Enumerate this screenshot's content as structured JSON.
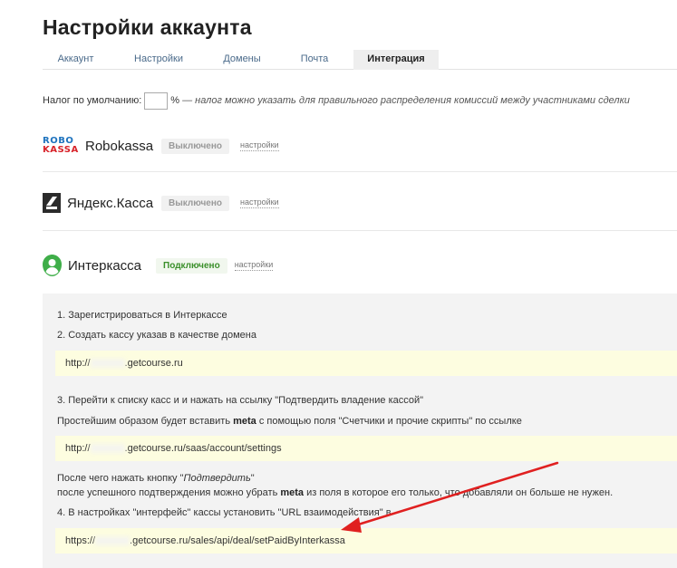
{
  "page": {
    "title": "Настройки аккаунта"
  },
  "tabs": [
    {
      "label": "Аккаунт"
    },
    {
      "label": "Настройки"
    },
    {
      "label": "Домены"
    },
    {
      "label": "Почта"
    },
    {
      "label": "Интеграция"
    }
  ],
  "active_tab": "Интеграция",
  "tax": {
    "label": "Налог по умолчанию:",
    "value": "",
    "percent": "%",
    "note": "— налог можно указать для правильного распределения комиссий между участниками сделки"
  },
  "providers": [
    {
      "logo_top": "ROBO",
      "logo_bottom": "KASSA",
      "name": "Robokassa",
      "status": "Выключено",
      "link": "настройки",
      "icon": "robokassa-logo"
    },
    {
      "name": "Яндекс.Касса",
      "status": "Выключено",
      "link": "настройки",
      "icon": "yandex-kassa-logo"
    },
    {
      "name": "Интеркасса",
      "status": "Подключено",
      "link": "настройки",
      "icon": "interkassa-logo"
    }
  ],
  "instructions": {
    "step1": "1. Зарегистрироваться в Интеркассе",
    "step2": "2. Создать кассу указав в качестве домена",
    "url1_prefix": "http://",
    "url1_suffix": ".getcourse.ru",
    "step3": "3. Перейти к списку касс и и нажать на ссылку \"Подтвердить владение кассой\"",
    "meta_pre": "Простейшим образом будет вставить ",
    "meta_word": "meta",
    "meta_post": " с помощью поля \"Счетчики и прочие скрипты\" по ссылке",
    "url2_prefix": "http://",
    "url2_suffix": ".getcourse.ru/saas/account/settings",
    "confirm_pre": "После чего нажать кнопку \"",
    "confirm_btn": "Подтвердить",
    "confirm_post": "\"",
    "after_pre": "после успешного подтверждения можно убрать ",
    "after_word": "meta",
    "after_post": " из поля в которое его только, что добавляли он больше не нужен.",
    "step4": "4. В настройках \"интерфейс\" кассы установить \"URL взаимодействия\" в",
    "url3_prefix": "https://",
    "url3_suffix": ".getcourse.ru/sales/api/deal/setPaidByInterkassa"
  },
  "annotation": {
    "color": "#e02020"
  },
  "colors": {
    "status_on": "#3a8f2a",
    "status_off": "#999999",
    "url_bg": "#fdfde0",
    "info_bg": "#f3f3f3"
  }
}
